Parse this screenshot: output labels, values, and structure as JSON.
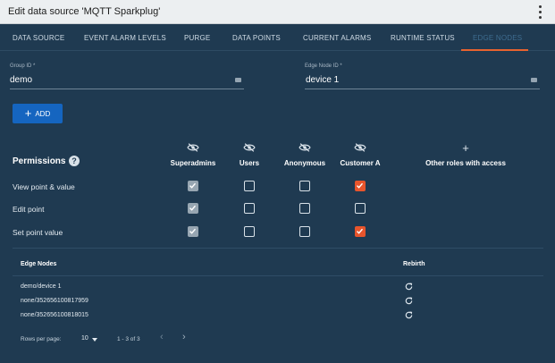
{
  "titlebar": {
    "title": "Edit data source 'MQTT Sparkplug'",
    "menu_icon": "kebab-menu-icon"
  },
  "tabs": [
    {
      "label": "DATA SOURCE"
    },
    {
      "label": "EVENT ALARM LEVELS"
    },
    {
      "label": "PURGE"
    },
    {
      "label": "DATA POINTS"
    },
    {
      "label": "CURRENT ALARMS"
    },
    {
      "label": "RUNTIME STATUS"
    },
    {
      "label": "EDGE NODES",
      "active": true
    }
  ],
  "fields": {
    "group_id": {
      "label": "Group ID *",
      "value": "demo"
    },
    "edge_node_id": {
      "label": "Edge Node ID *",
      "value": "device 1"
    }
  },
  "add_button": {
    "label": "ADD"
  },
  "permissions": {
    "title": "Permissions",
    "help": "?",
    "columns": [
      {
        "label": "Superadmins",
        "icon": "eye-off-icon"
      },
      {
        "label": "Users",
        "icon": "eye-off-icon"
      },
      {
        "label": "Anonymous",
        "icon": "eye-off-icon"
      },
      {
        "label": "Customer A",
        "icon": "eye-off-icon"
      },
      {
        "label": "Other roles with access",
        "icon": "plus-icon"
      }
    ],
    "rows": [
      {
        "label": "View point & value",
        "states": [
          "disabled",
          "unchecked",
          "unchecked",
          "checked"
        ]
      },
      {
        "label": "Edit point",
        "states": [
          "disabled",
          "unchecked",
          "unchecked",
          "unchecked"
        ]
      },
      {
        "label": "Set point value",
        "states": [
          "disabled",
          "unchecked",
          "unchecked",
          "checked"
        ]
      }
    ]
  },
  "edge_nodes_table": {
    "headers": {
      "name": "Edge Nodes",
      "rebirth": "Rebirth"
    },
    "rows": [
      {
        "name": "demo/device 1"
      },
      {
        "name": "none/352656100817959"
      },
      {
        "name": "none/352656100818015"
      }
    ],
    "pagination": {
      "rows_per_page_label": "Rows per page:",
      "rows_per_page": "10",
      "range": "1 - 3 of 3"
    }
  },
  "colors": {
    "background": "#1f3a51",
    "accent": "#e8632f",
    "primary_button": "#1565c0",
    "checked": "#e8552c"
  }
}
